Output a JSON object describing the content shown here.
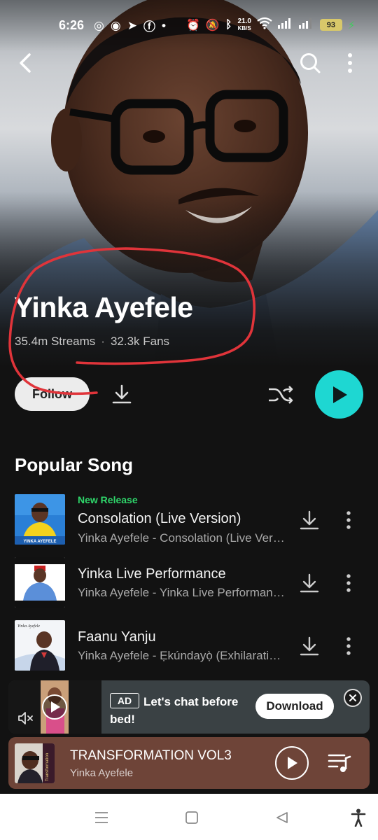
{
  "status_bar": {
    "time": "6:26",
    "net_speed_value": "21.0",
    "net_speed_unit": "KB/S",
    "battery": "93"
  },
  "artist": {
    "name": "Yinka Ayefele",
    "streams": "35.4m Streams",
    "separator": "·",
    "fans": "32.3k Fans"
  },
  "actions": {
    "follow_label": "Follow"
  },
  "section": {
    "title": "Popular Song"
  },
  "songs": [
    {
      "badge": "New Release",
      "title": "Consolation (Live Version)",
      "subtitle": "Yinka Ayefele - Consolation (Live Version)",
      "thumb_text": "YINKA AYEFELE"
    },
    {
      "badge": "",
      "title": "Yinka Live Performance",
      "subtitle": "Yinka Ayefele - Yinka Live Performance",
      "thumb_text": ""
    },
    {
      "badge": "",
      "title": "Faanu Yanju",
      "subtitle": "Yinka Ayefele - Ẹkúndayọ̀ (Exhilaration)",
      "thumb_text": "Yinka Ayefele"
    }
  ],
  "ad": {
    "tag": "AD",
    "text": "Let's chat before bed!",
    "cta": "Download"
  },
  "player": {
    "title": "TRANSFORMATION VOL3",
    "artist": "Yinka Ayefele",
    "thumb_text": "Transformation"
  },
  "colors": {
    "accent": "#1ed7d2",
    "badge_green": "#2fd76b",
    "player_bg": "#6e4438",
    "annotation": "#e0343a"
  },
  "icons": [
    "back-icon",
    "search-icon",
    "more-vert-icon",
    "download-icon",
    "shuffle-icon",
    "play-icon",
    "mute-icon",
    "close-icon",
    "queue-music-icon",
    "menu-icon",
    "home-square-icon",
    "back-triangle-icon",
    "accessibility-icon"
  ]
}
